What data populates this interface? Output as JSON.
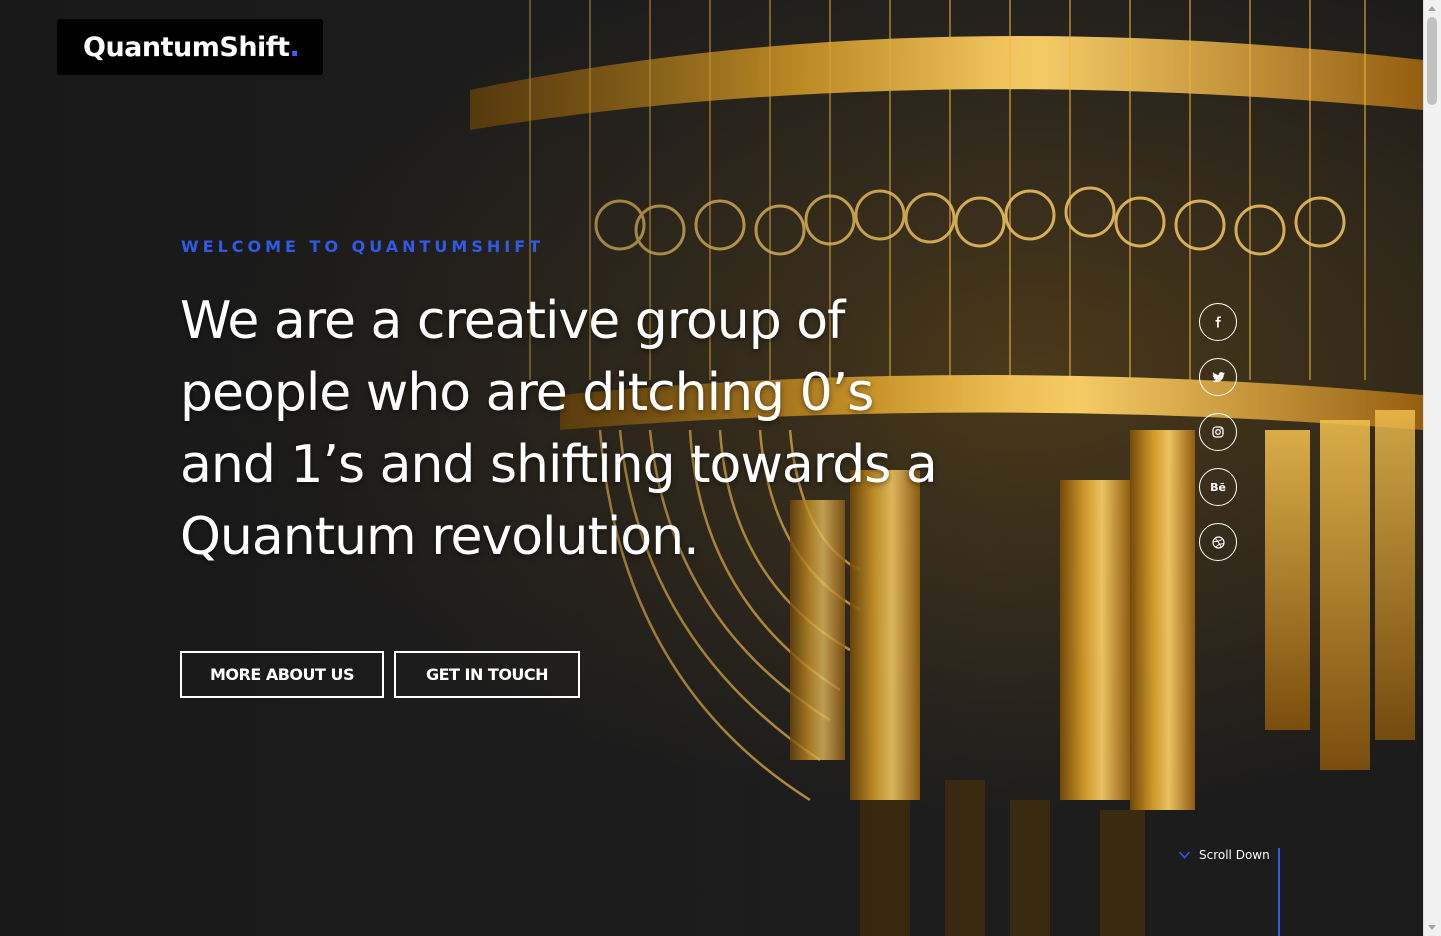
{
  "brand": {
    "name": "QuantumShift",
    "dot": ".",
    "accent_color": "#2f5be8"
  },
  "hero": {
    "eyebrow": "WELCOME TO QUANTUMSHIFT",
    "headline_lines": [
      "We are a creative group of",
      "people who are ditching 0’s",
      "and 1’s and shifting towards a",
      "Quantum revolution."
    ],
    "image_subject": "gold quantum computer chandelier"
  },
  "buttons": {
    "about": "MORE ABOUT US",
    "touch": "GET IN TOUCH"
  },
  "social": [
    {
      "icon": "facebook-icon",
      "glyph": "f"
    },
    {
      "icon": "twitter-icon",
      "glyph": "🐦"
    },
    {
      "icon": "instagram-icon",
      "glyph": "◎"
    },
    {
      "icon": "behance-icon",
      "glyph": "Bē"
    },
    {
      "icon": "dribbble-icon",
      "glyph": "◍"
    }
  ],
  "scroll": {
    "label": "Scroll Down"
  }
}
